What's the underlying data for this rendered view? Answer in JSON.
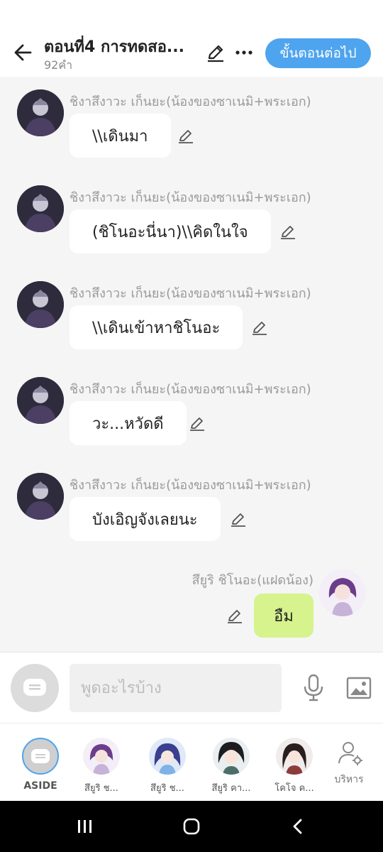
{
  "header": {
    "title": "ตอนที่4 การทดสอ...",
    "word_count": "92คำ",
    "next_label": "ขั้นตอนต่อไป",
    "accent": "#4ea4ee"
  },
  "messages": [
    {
      "sender": "ชิงาสึงาวะ เก็นยะ(น้องของซาเนมิ+พระเอก)",
      "text": "\\\\เดินมา"
    },
    {
      "sender": "ชิงาสึงาวะ เก็นยะ(น้องของซาเนมิ+พระเอก)",
      "text": "(ชิโนอะนี่นา)\\\\คิดในใจ"
    },
    {
      "sender": "ชิงาสึงาวะ เก็นยะ(น้องของซาเนมิ+พระเอก)",
      "text": "\\\\เดินเข้าหาชิโนอะ"
    },
    {
      "sender": "ชิงาสึงาวะ เก็นยะ(น้องของซาเนมิ+พระเอก)",
      "text": "วะ...หวัดดี"
    },
    {
      "sender": "ชิงาสึงาวะ เก็นยะ(น้องของซาเนมิ+พระเอก)",
      "text": "บังเอิญจังเลยนะ"
    }
  ],
  "my_message": {
    "sender": "สึยูริ ชิโนอะ(แฝดน้อง)",
    "text": "อืม",
    "bubble_color": "#d6f38e"
  },
  "input": {
    "placeholder": "พูดอะไรบ้าง",
    "value": ""
  },
  "characters": [
    {
      "label": "ASIDE"
    },
    {
      "label": "สึยูริ ช..."
    },
    {
      "label": "สึยูริ ช..."
    },
    {
      "label": "สึยูริ คา..."
    },
    {
      "label": "โคโจ ค..."
    }
  ],
  "manage_label": "บริหาร",
  "icons": [
    "back-arrow-icon",
    "pencil-icon",
    "more-dots-icon",
    "chat-bubble-icon",
    "mic-icon",
    "image-icon",
    "user-gear-icon",
    "recents-icon",
    "home-icon",
    "nav-back-icon"
  ]
}
